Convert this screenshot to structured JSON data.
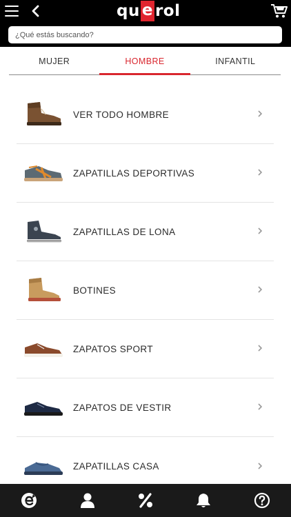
{
  "header": {
    "logo_left": "qu",
    "logo_e": "e",
    "logo_right": "rol",
    "search_placeholder": "¿Qué estás buscando?"
  },
  "tabs": [
    {
      "label": "MUJER",
      "active": false
    },
    {
      "label": "HOMBRE",
      "active": true
    },
    {
      "label": "INFANTIL",
      "active": false
    }
  ],
  "categories": [
    {
      "label": "VER TODO HOMBRE",
      "icon": "brown-boot-icon"
    },
    {
      "label": "ZAPATILLAS DEPORTIVAS",
      "icon": "sneaker-icon"
    },
    {
      "label": "ZAPATILLAS DE LONA",
      "icon": "canvas-sneaker-icon"
    },
    {
      "label": "BOTINES",
      "icon": "ankle-boot-icon"
    },
    {
      "label": "ZAPATOS SPORT",
      "icon": "sport-shoe-icon"
    },
    {
      "label": "ZAPATOS DE VESTIR",
      "icon": "dress-shoe-icon"
    },
    {
      "label": "ZAPATILLAS CASA",
      "icon": "slipper-icon"
    }
  ],
  "bottom_nav": [
    {
      "name": "home",
      "icon": "querol-e-icon"
    },
    {
      "name": "account",
      "icon": "user-icon"
    },
    {
      "name": "offers",
      "icon": "percent-icon"
    },
    {
      "name": "notifications",
      "icon": "bell-icon"
    },
    {
      "name": "help",
      "icon": "help-icon"
    }
  ],
  "colors": {
    "accent": "#d9262e",
    "header_bg": "#000000",
    "nav_bg": "#1a1a1a"
  }
}
